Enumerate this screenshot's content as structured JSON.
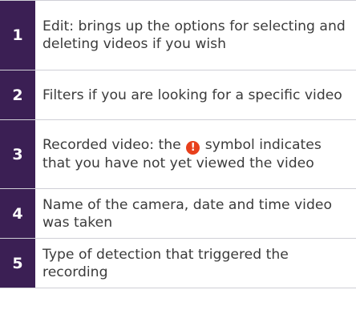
{
  "rows": [
    {
      "num": "1",
      "text": "Edit: brings up the options for selecting and deleting videos if you wish"
    },
    {
      "num": "2",
      "text": "Filters if you are looking for a specific video"
    },
    {
      "num": "3",
      "text_before": "Recorded video: the",
      "icon": "alert-icon",
      "icon_glyph": "!",
      "text_after": "symbol indicates that you have not yet viewed the video"
    },
    {
      "num": "4",
      "text": "Name of the camera, date and time video was taken"
    },
    {
      "num": "5",
      "text": "Type of detection that triggered the recording"
    }
  ],
  "colors": {
    "number_bg": "#3b1f54",
    "alert": "#e8401c",
    "text": "#3b3b3b"
  }
}
